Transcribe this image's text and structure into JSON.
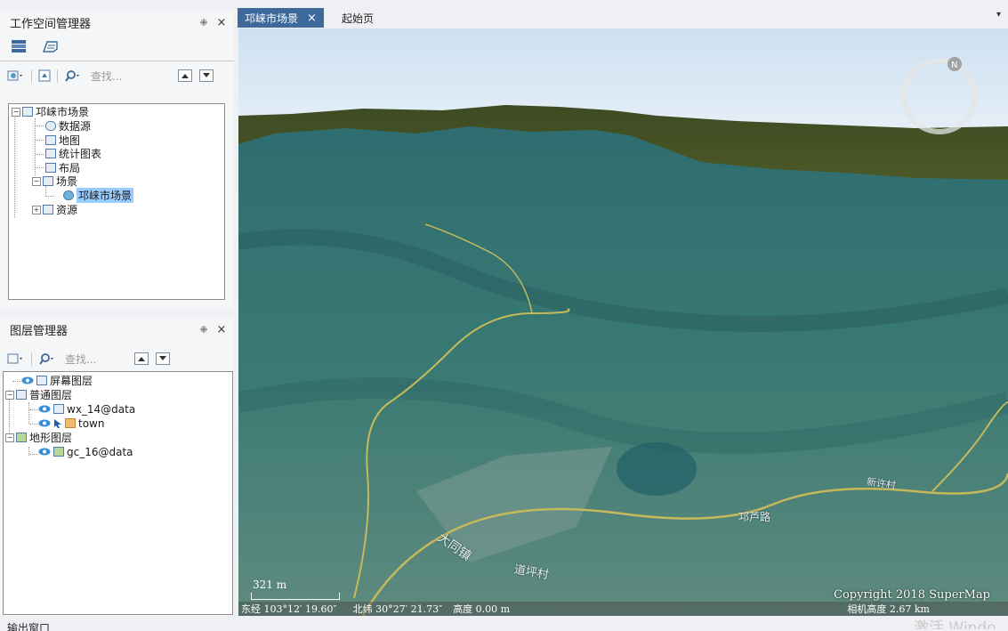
{
  "workspace_panel": {
    "title": "工作空间管理器",
    "pin": "⁜",
    "close": "×",
    "search_placeholder": "查找...",
    "tree": [
      {
        "label": "邛崃市场景"
      },
      {
        "label": "数据源"
      },
      {
        "label": "地图"
      },
      {
        "label": "统计图表"
      },
      {
        "label": "布局"
      },
      {
        "label": "场景"
      },
      {
        "label": "邛崃市场景"
      },
      {
        "label": "资源"
      }
    ]
  },
  "layer_panel": {
    "title": "图层管理器",
    "pin": "⁜",
    "close": "×",
    "search_placeholder": "查找...",
    "tree": [
      {
        "label": "屏幕图层"
      },
      {
        "label": "普通图层"
      },
      {
        "label": "wx_14@data"
      },
      {
        "label": "town"
      },
      {
        "label": "地形图层"
      },
      {
        "label": "gc_16@data"
      }
    ]
  },
  "tabs": [
    {
      "label": "邛崃市场景",
      "close": "×",
      "active": true
    },
    {
      "label": "起始页",
      "active": false
    }
  ],
  "tab_menu": "▾",
  "scene": {
    "scale_label": "321 m",
    "copyright": "Copyright 2018 SuperMap",
    "status": {
      "longitude": "东经 103°12′ 19.60″",
      "latitude": "北纬 30°27′ 21.73″",
      "elevation": "高度 0.00 m",
      "camera_height": "相机高度 2.67 km"
    },
    "labels": [
      "邛芦路",
      "新许村",
      "大同镇",
      "道坪村"
    ],
    "compass_letter": "N"
  },
  "bottom": {
    "output_label": "输出窗口",
    "watermark": "激活 Windo"
  },
  "colors": {
    "accent": "#3d6a9a",
    "selection": "#99ccff"
  }
}
